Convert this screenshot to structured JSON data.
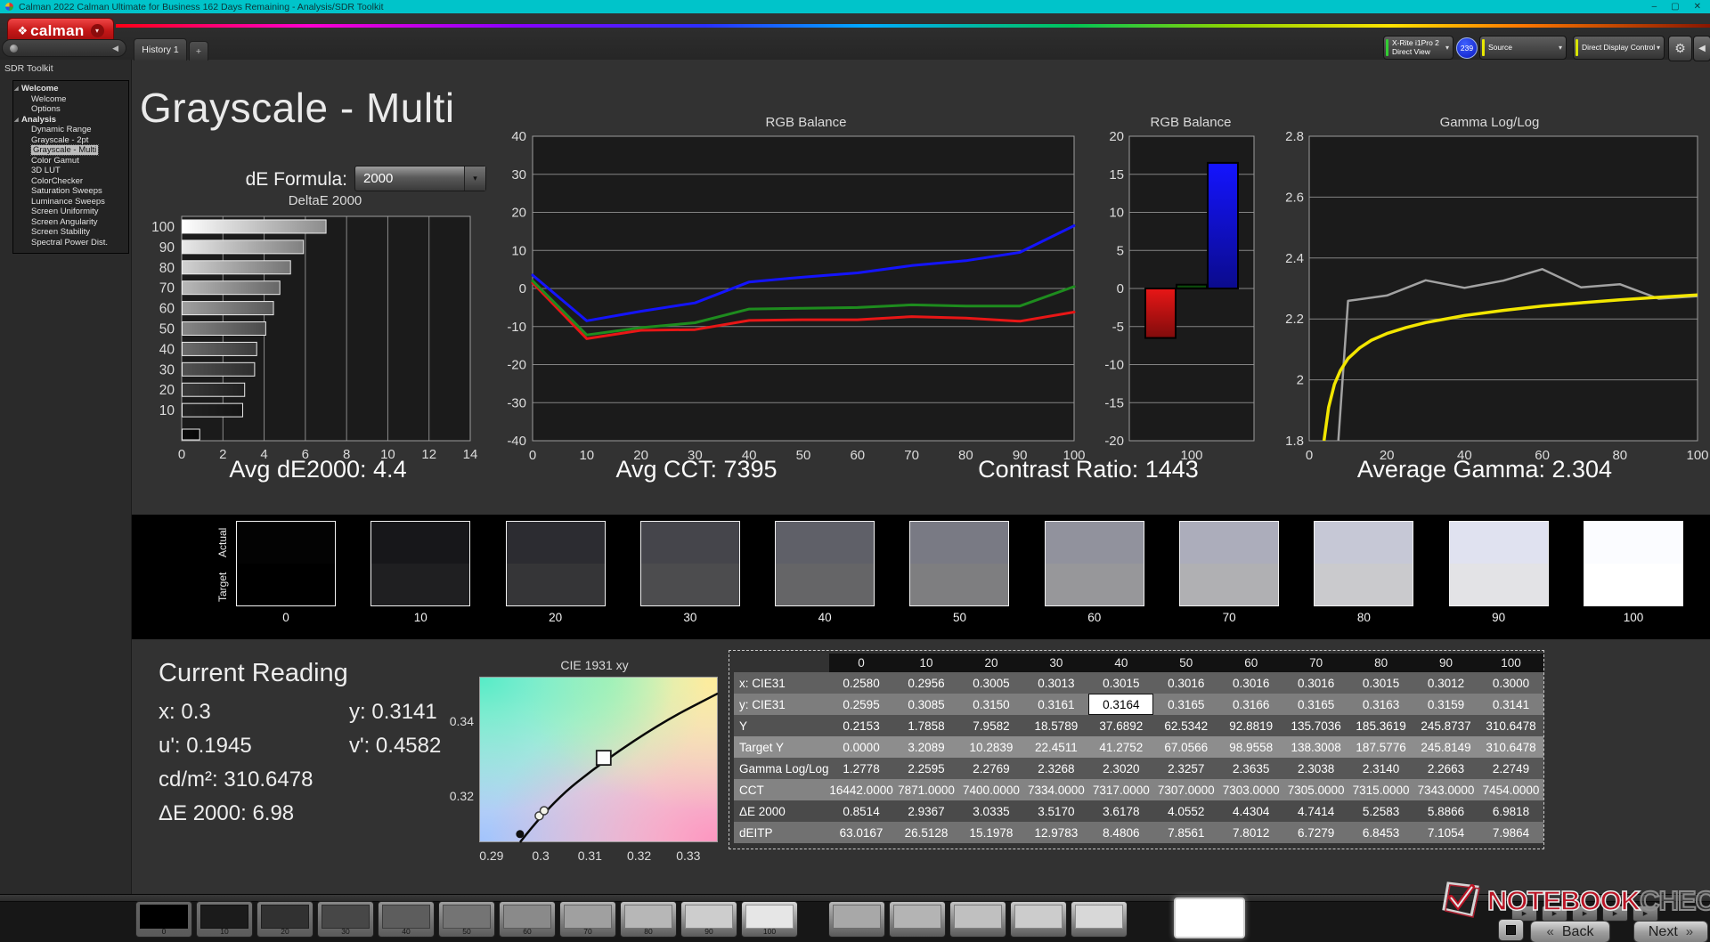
{
  "titlebar": {
    "title": "Calman 2022 Calman Ultimate for Business 162 Days Remaining  - Analysis/SDR Toolkit",
    "minimize_icon": "–",
    "maximize_icon": "▢",
    "close_icon": "✕"
  },
  "chrome": {
    "logo_mark": "❖",
    "logo_text": "calman",
    "history_tab": "History 1",
    "add_tab": "+",
    "meter": {
      "line1": "X-Rite i1Pro 2",
      "line2": "Direct View",
      "badge": "239",
      "accent_color": "#33cc33"
    },
    "source": {
      "label": "Source",
      "accent_color": "#e8e800"
    },
    "display_control": {
      "label": "Direct Display Control",
      "accent_color": "#d8e400"
    }
  },
  "icons": {
    "dropdown": "▾",
    "collapse_left": "◀",
    "gear": "⚙",
    "pill_dot": "",
    "play": "▶",
    "back_chevrons": "«",
    "next_chevrons": "»"
  },
  "sidebar": {
    "header": "SDR Toolkit",
    "tree": [
      {
        "label": "Welcome",
        "bold": true,
        "arrow": true
      },
      {
        "label": "Welcome"
      },
      {
        "label": "Options"
      },
      {
        "label": "Analysis",
        "bold": true,
        "arrow": true
      },
      {
        "label": "Dynamic Range"
      },
      {
        "label": "Grayscale - 2pt"
      },
      {
        "label": "Grayscale - Multi",
        "selected": true
      },
      {
        "label": "Color Gamut"
      },
      {
        "label": "3D LUT"
      },
      {
        "label": "ColorChecker"
      },
      {
        "label": "Saturation Sweeps"
      },
      {
        "label": "Luminance Sweeps"
      },
      {
        "label": "Screen Uniformity"
      },
      {
        "label": "Screen Angularity"
      },
      {
        "label": "Screen Stability"
      },
      {
        "label": "Spectral Power Dist."
      }
    ]
  },
  "main": {
    "title": "Grayscale - Multi",
    "de_formula_label": "dE Formula:",
    "de_formula_value": "2000",
    "stats": [
      "Avg dE2000: 4.4",
      "Avg CCT: 7395",
      "Contrast Ratio: 1443",
      "Average Gamma: 2.304"
    ]
  },
  "chart_data": [
    {
      "id": "deltae",
      "type": "bar",
      "orientation": "horizontal",
      "title": "DeltaE 2000",
      "categories": [
        "100",
        "90",
        "80",
        "70",
        "60",
        "50",
        "40",
        "30",
        "20",
        "10",
        "0"
      ],
      "values": [
        6.9818,
        5.8866,
        5.2583,
        4.7414,
        4.4304,
        4.0552,
        3.6178,
        3.517,
        3.0335,
        2.9367,
        0.8514
      ],
      "bar_colors": [
        "#ffffff",
        "#e9e9e9",
        "#d2d2d2",
        "#b9b9b9",
        "#a0a0a0",
        "#868686",
        "#6c6c6c",
        "#525252",
        "#3a3a3a",
        "#242424",
        "#0d0d0d"
      ],
      "xlim": [
        0,
        14
      ],
      "xticks": [
        0,
        2,
        4,
        6,
        8,
        10,
        12,
        14
      ],
      "grid": true
    },
    {
      "id": "rgb_lines",
      "type": "line",
      "title": "RGB Balance",
      "x": [
        0,
        10,
        20,
        30,
        40,
        50,
        60,
        70,
        80,
        90,
        100
      ],
      "series": [
        {
          "name": "Red",
          "color": "#e81616",
          "values": [
            1.5,
            -13.2,
            -11.0,
            -10.8,
            -8.4,
            -8.2,
            -8.2,
            -7.4,
            -7.8,
            -8.6,
            -6.2
          ]
        },
        {
          "name": "Green",
          "color": "#1e8c1e",
          "values": [
            2.0,
            -12.2,
            -10.3,
            -9.0,
            -5.4,
            -5.2,
            -5.0,
            -4.3,
            -4.6,
            -4.6,
            0.5
          ]
        },
        {
          "name": "Blue",
          "color": "#1414ff",
          "values": [
            3.5,
            -8.5,
            -6.0,
            -3.8,
            1.7,
            3.0,
            4.1,
            6.0,
            7.3,
            9.5,
            16.5
          ]
        }
      ],
      "ylim": [
        -40,
        40
      ],
      "yticks": [
        40,
        30,
        20,
        10,
        0,
        -10,
        -20,
        -30,
        -40
      ],
      "xticks": [
        0,
        10,
        20,
        30,
        40,
        50,
        60,
        70,
        80,
        90,
        100
      ],
      "grid": true
    },
    {
      "id": "rgb_bars",
      "type": "bar",
      "title": "RGB Balance",
      "categories": [
        "100"
      ],
      "series": [
        {
          "name": "Red",
          "color": "#e81616",
          "value": -6.5
        },
        {
          "name": "Green",
          "color": "#0e5c0e",
          "value": 0.5
        },
        {
          "name": "Blue",
          "color": "#1414ff",
          "value": 16.5
        }
      ],
      "ylim": [
        -20,
        20
      ],
      "yticks": [
        20,
        15,
        10,
        5,
        0,
        -5,
        -10,
        -15,
        -20
      ],
      "grid": true
    },
    {
      "id": "gamma",
      "type": "line",
      "title": "Gamma Log/Log",
      "series": [
        {
          "name": "Measured",
          "color": "#a2a2a2",
          "points": [
            [
              7.5,
              1.8
            ],
            [
              10,
              2.2595
            ],
            [
              20,
              2.2769
            ],
            [
              30,
              2.3268
            ],
            [
              40,
              2.302
            ],
            [
              50,
              2.3257
            ],
            [
              60,
              2.3635
            ],
            [
              70,
              2.3038
            ],
            [
              80,
              2.314
            ],
            [
              90,
              2.2663
            ],
            [
              100,
              2.2749
            ]
          ]
        },
        {
          "name": "Target",
          "color": "#f2e600",
          "points": [
            [
              3.8,
              1.8
            ],
            [
              5,
              1.91
            ],
            [
              6.5,
              1.985
            ],
            [
              8,
              2.03
            ],
            [
              10,
              2.07
            ],
            [
              13,
              2.105
            ],
            [
              16,
              2.13
            ],
            [
              20,
              2.152
            ],
            [
              25,
              2.172
            ],
            [
              30,
              2.188
            ],
            [
              40,
              2.211
            ],
            [
              50,
              2.228
            ],
            [
              60,
              2.242
            ],
            [
              70,
              2.253
            ],
            [
              80,
              2.263
            ],
            [
              90,
              2.271
            ],
            [
              100,
              2.279
            ]
          ]
        }
      ],
      "xlim": [
        0,
        100
      ],
      "ylim": [
        1.8,
        2.8
      ],
      "yticks": [
        2.8,
        2.6,
        2.4,
        2.2,
        2,
        1.8
      ],
      "xticks": [
        0,
        20,
        40,
        60,
        80,
        100
      ],
      "grid": true
    },
    {
      "id": "cie",
      "type": "scatter",
      "title": "CIE 1931 xy",
      "xlim": [
        0.2875,
        0.336
      ],
      "ylim": [
        0.3075,
        0.352
      ],
      "xticks": [
        0.29,
        0.3,
        0.31,
        0.32,
        0.33
      ],
      "yticks": [
        0.34,
        0.32
      ],
      "locus": [
        [
          0.2958,
          0.3075
        ],
        [
          0.302,
          0.318
        ],
        [
          0.313,
          0.3295
        ],
        [
          0.325,
          0.34
        ],
        [
          0.336,
          0.3475
        ]
      ],
      "points": [
        {
          "x": 0.2958,
          "y": 0.3097,
          "type": "filled-dot"
        },
        {
          "x": 0.2997,
          "y": 0.3146,
          "type": "open-dot"
        },
        {
          "x": 0.3007,
          "y": 0.316,
          "type": "open-dot"
        },
        {
          "x": 0.3128,
          "y": 0.3302,
          "type": "target-square"
        }
      ]
    }
  ],
  "strip": {
    "actual_label": "Actual",
    "target_label": "Target",
    "levels": [
      {
        "label": "0",
        "actual": "#030303",
        "target": "#000000"
      },
      {
        "label": "10",
        "actual": "#17171a",
        "target": "#1f1f21"
      },
      {
        "label": "20",
        "actual": "#2c2c31",
        "target": "#353537"
      },
      {
        "label": "30",
        "actual": "#45454b",
        "target": "#4c4c4e"
      },
      {
        "label": "40",
        "actual": "#5f6068",
        "target": "#656567"
      },
      {
        "label": "50",
        "actual": "#797a84",
        "target": "#7e7e80"
      },
      {
        "label": "60",
        "actual": "#91929d",
        "target": "#97979a"
      },
      {
        "label": "70",
        "actual": "#acadbb",
        "target": "#b0b0b3"
      },
      {
        "label": "80",
        "actual": "#c6c8d6",
        "target": "#cacacd"
      },
      {
        "label": "90",
        "actual": "#e0e2f0",
        "target": "#e3e3e6"
      },
      {
        "label": "100",
        "actual": "#fbfcff",
        "target": "#ffffff"
      }
    ]
  },
  "current_reading": {
    "heading": "Current Reading",
    "x_label": "x:",
    "x_value": "0.3",
    "y_label": "y:",
    "y_value": "0.3141",
    "u_label": "u':",
    "u_value": "0.1945",
    "v_label": "v':",
    "v_value": "0.4582",
    "lum_label": "cd/m²:",
    "lum_value": "310.6478",
    "de_label": "ΔE 2000:",
    "de_value": "6.98"
  },
  "table": {
    "columns": [
      "0",
      "10",
      "20",
      "30",
      "40",
      "50",
      "60",
      "70",
      "80",
      "90",
      "100"
    ],
    "rows": [
      {
        "label": "x: CIE31",
        "bg": "#606060",
        "values": [
          "0.2580",
          "0.2956",
          "0.3005",
          "0.3013",
          "0.3015",
          "0.3016",
          "0.3016",
          "0.3016",
          "0.3015",
          "0.3012",
          "0.3000"
        ]
      },
      {
        "label": "y: CIE31",
        "bg": "#7d7d7d",
        "highlight": 4,
        "values": [
          "0.2595",
          "0.3085",
          "0.3150",
          "0.3161",
          "0.3164",
          "0.3165",
          "0.3166",
          "0.3165",
          "0.3163",
          "0.3159",
          "0.3141"
        ]
      },
      {
        "label": "Y",
        "bg": "#525252",
        "values": [
          "0.2153",
          "1.7858",
          "7.9582",
          "18.5789",
          "37.6892",
          "62.5342",
          "92.8819",
          "135.7036",
          "185.3619",
          "245.8737",
          "310.6478"
        ]
      },
      {
        "label": "Target Y",
        "bg": "#8d8d8d",
        "values": [
          "0.0000",
          "3.2089",
          "10.2839",
          "22.4511",
          "41.2752",
          "67.0566",
          "98.9558",
          "138.3008",
          "187.5776",
          "245.8149",
          "310.6478"
        ]
      },
      {
        "label": "Gamma Log/Log",
        "bg": "#575757",
        "values": [
          "1.2778",
          "2.2595",
          "2.2769",
          "2.3268",
          "2.3020",
          "2.3257",
          "2.3635",
          "2.3038",
          "2.3140",
          "2.2663",
          "2.2749"
        ]
      },
      {
        "label": "CCT",
        "bg": "#838383",
        "values": [
          "16442.0000",
          "7871.0000",
          "7400.0000",
          "7334.0000",
          "7317.0000",
          "7307.0000",
          "7303.0000",
          "7305.0000",
          "7315.0000",
          "7343.0000",
          "7454.0000"
        ]
      },
      {
        "label": "ΔE 2000",
        "bg": "#4a4a4a",
        "values": [
          "0.8514",
          "2.9367",
          "3.0335",
          "3.5170",
          "3.6178",
          "4.0552",
          "4.4304",
          "4.7414",
          "5.2583",
          "5.8866",
          "6.9818"
        ]
      },
      {
        "label": "dEITP",
        "bg": "#717171",
        "values": [
          "63.0167",
          "26.5128",
          "15.1978",
          "12.9783",
          "8.4806",
          "7.8561",
          "7.8012",
          "6.7279",
          "6.8453",
          "7.1054",
          "7.9864"
        ]
      }
    ]
  },
  "bottom": {
    "patches": [
      {
        "label": "0",
        "color": "#000000"
      },
      {
        "label": "10",
        "color": "#1b1b1b"
      },
      {
        "label": "20",
        "color": "#313131"
      },
      {
        "label": "30",
        "color": "#474747"
      },
      {
        "label": "40",
        "color": "#5d5d5d"
      },
      {
        "label": "50",
        "color": "#747474"
      },
      {
        "label": "60",
        "color": "#8a8a8a"
      },
      {
        "label": "70",
        "color": "#a0a0a0"
      },
      {
        "label": "80",
        "color": "#b7b7b7"
      },
      {
        "label": "90",
        "color": "#cdcdcd"
      },
      {
        "label": "100",
        "color": "#e6e6e6"
      }
    ],
    "extra_patches": [
      "#a8a8a8",
      "#b4b4b4",
      "#c0c0c0",
      "#cccccc",
      "#d8d8d8"
    ],
    "selected_patch_color": "#ffffff",
    "transport_icons": [
      "▶",
      "▶",
      "▶",
      "▶",
      "▶"
    ],
    "back_label": "Back",
    "next_label": "Next"
  },
  "watermark": {
    "text1": "NOTEBOOK",
    "text2": "CHECK"
  }
}
